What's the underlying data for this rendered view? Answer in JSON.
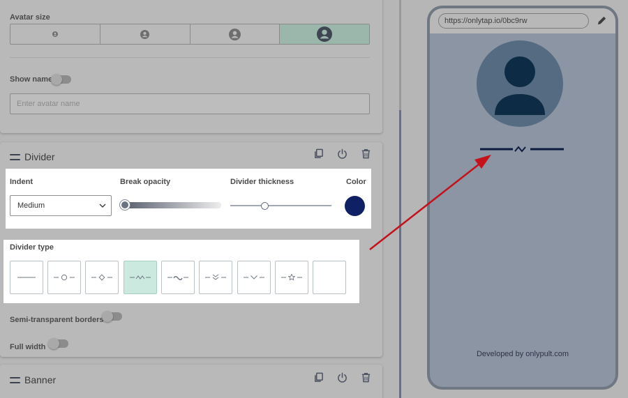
{
  "avatar_panel": {
    "size_label": "Avatar size",
    "size_options": [
      "xs",
      "s",
      "m",
      "l"
    ],
    "selected_size": "l",
    "show_name_label": "Show name",
    "show_name_on": false,
    "name_placeholder": "Enter avatar name"
  },
  "divider_panel": {
    "title": "Divider",
    "indent_label": "Indent",
    "indent_value": "Medium",
    "break_opacity_label": "Break opacity",
    "break_opacity_value": 0.0,
    "thickness_label": "Divider thickness",
    "thickness_value": 0.34,
    "color_label": "Color",
    "color": "#0f2064",
    "type_label": "Divider type",
    "types": [
      "plain",
      "circle",
      "diamond",
      "wave",
      "tilde",
      "double-chevron",
      "chevron",
      "star",
      "none"
    ],
    "selected_type": "wave",
    "semi_transparent_label": "Semi-transparent borders",
    "semi_transparent_on": false,
    "full_width_label": "Full width",
    "full_width_on": false
  },
  "banner_panel": {
    "title": "Banner"
  },
  "preview": {
    "url": "https://onlytap.io/0bc9rw",
    "footer": "Developed by onlypult.com",
    "divider_color": "#0f2064"
  },
  "icons": {
    "header_actions": [
      "copy-icon",
      "power-icon",
      "trash-icon"
    ],
    "edit": "pencil-icon"
  }
}
